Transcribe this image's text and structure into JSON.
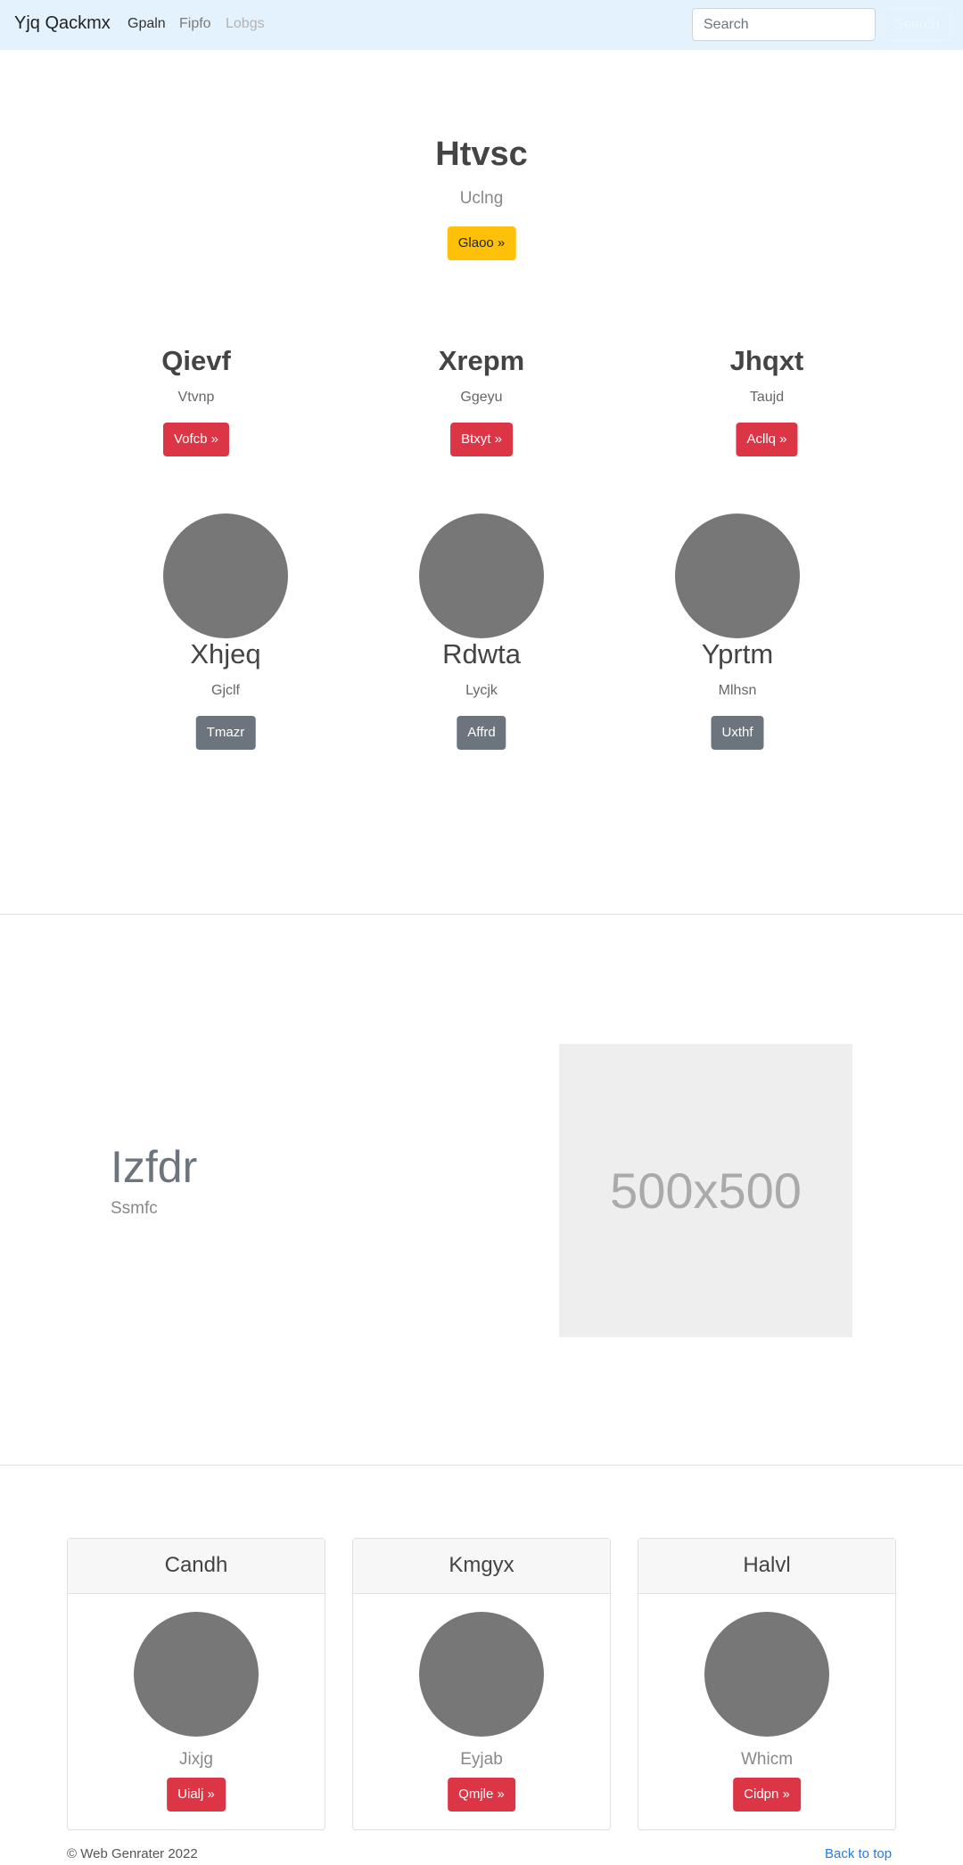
{
  "navbar": {
    "brand": "Yjq Qackmx",
    "links": [
      {
        "label": "Gpaln",
        "state": "active"
      },
      {
        "label": "Fipfo",
        "state": "normal"
      },
      {
        "label": "Lobgs",
        "state": "disabled"
      }
    ],
    "search": {
      "placeholder": "Search",
      "button_label": "Search"
    }
  },
  "hero": {
    "title": "Htvsc",
    "subtitle": "Uclng",
    "button_label": "Glaoo »"
  },
  "features": [
    {
      "title": "Qievf",
      "text": "Vtvnp",
      "button_label": "Vofcb »"
    },
    {
      "title": "Xrepm",
      "text": "Ggeyu",
      "button_label": "Btxyt »"
    },
    {
      "title": "Jhqxt",
      "text": "Taujd",
      "button_label": "Acllq »"
    }
  ],
  "people": [
    {
      "name": "Xhjeq",
      "text": "Gjclf",
      "button_label": "Tmazr"
    },
    {
      "name": "Rdwta",
      "text": "Lycjk",
      "button_label": "Affrd"
    },
    {
      "name": "Yprtm",
      "text": "Mlhsn",
      "button_label": "Uxthf"
    }
  ],
  "featurette": {
    "heading": "Izfdr",
    "text": "Ssmfc",
    "image_label": "500x500"
  },
  "cards": [
    {
      "header": "Candh",
      "text": "Jixjg",
      "button_label": "Uialj »"
    },
    {
      "header": "Kmgyx",
      "text": "Eyjab",
      "button_label": "Qmjle »"
    },
    {
      "header": "Halvl",
      "text": "Whicm",
      "button_label": "Cidpn »"
    }
  ],
  "footer": {
    "copyright": "© Web Genrater 2022",
    "back_to_top": "Back to top"
  },
  "colors": {
    "navbar_bg": "#e3f2fd",
    "warning": "#ffc107",
    "danger": "#dc3545",
    "secondary": "#6c757d",
    "link": "#2a7bd8",
    "avatar": "#777777"
  }
}
